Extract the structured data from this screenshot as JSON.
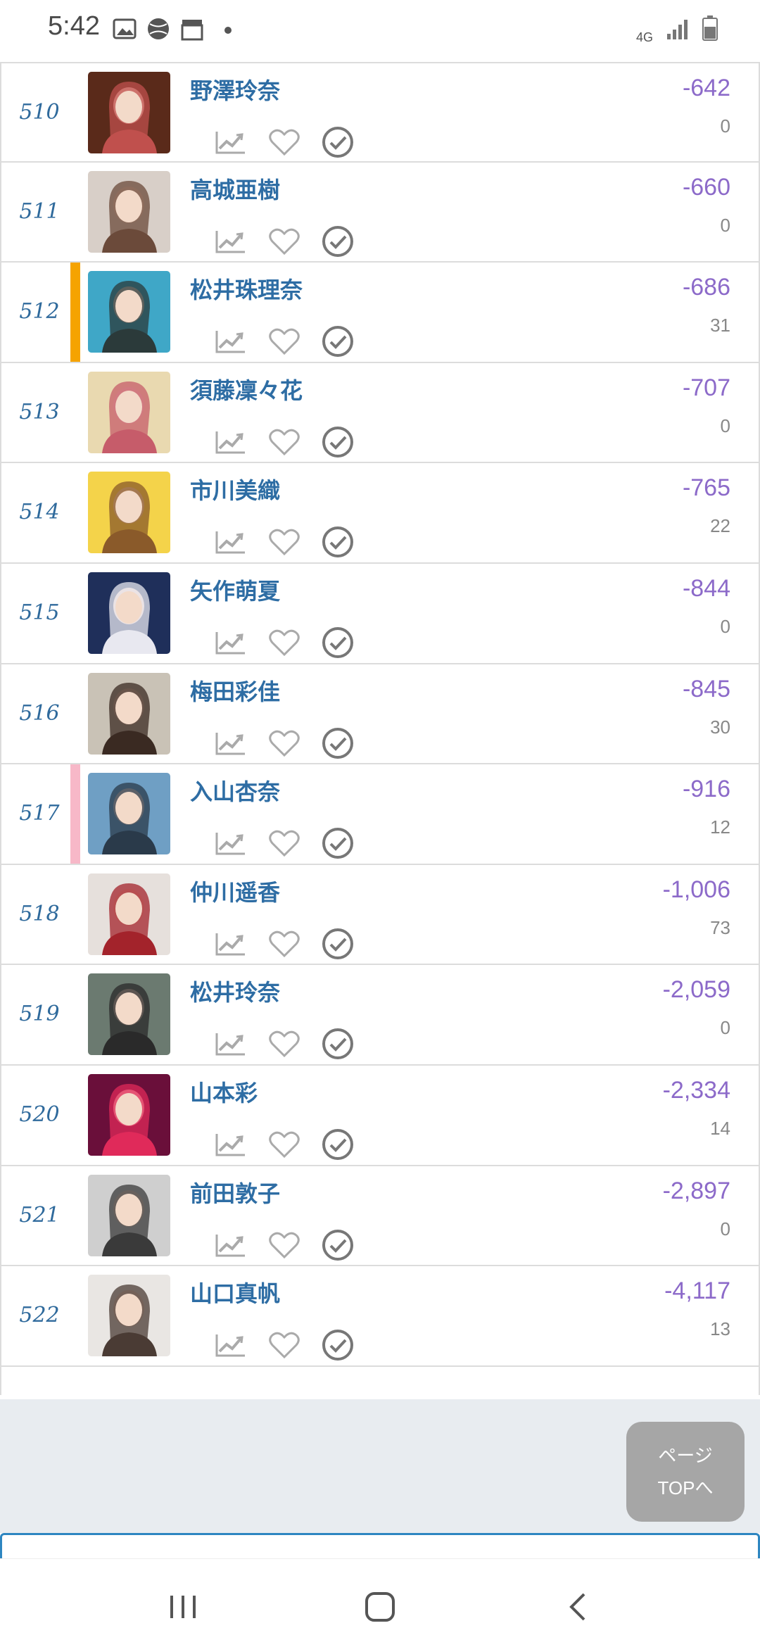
{
  "status_bar": {
    "time": "5:42",
    "network": "4G",
    "icons": [
      "gallery-icon",
      "sports-icon",
      "clapper-icon",
      "dot-icon",
      "signal-icon",
      "battery-icon"
    ]
  },
  "colors": {
    "name": "#2e6da4",
    "score": "#8c6ac9",
    "rank": "#2f6a9c",
    "marker_orange": "#f5a300",
    "marker_pink": "#f7b8c8"
  },
  "rows": [
    {
      "rank": "510",
      "name": "野澤玲奈",
      "score": "-642",
      "count": "0",
      "marker": ""
    },
    {
      "rank": "511",
      "name": "高城亜樹",
      "score": "-660",
      "count": "0",
      "marker": ""
    },
    {
      "rank": "512",
      "name": "松井珠理奈",
      "score": "-686",
      "count": "31",
      "marker": "orange"
    },
    {
      "rank": "513",
      "name": "須藤凜々花",
      "score": "-707",
      "count": "0",
      "marker": ""
    },
    {
      "rank": "514",
      "name": "市川美織",
      "score": "-765",
      "count": "22",
      "marker": ""
    },
    {
      "rank": "515",
      "name": "矢作萌夏",
      "score": "-844",
      "count": "0",
      "marker": ""
    },
    {
      "rank": "516",
      "name": "梅田彩佳",
      "score": "-845",
      "count": "30",
      "marker": ""
    },
    {
      "rank": "517",
      "name": "入山杏奈",
      "score": "-916",
      "count": "12",
      "marker": "pink"
    },
    {
      "rank": "518",
      "name": "仲川遥香",
      "score": "-1,006",
      "count": "73",
      "marker": ""
    },
    {
      "rank": "519",
      "name": "松井玲奈",
      "score": "-2,059",
      "count": "0",
      "marker": ""
    },
    {
      "rank": "520",
      "name": "山本彩",
      "score": "-2,334",
      "count": "14",
      "marker": ""
    },
    {
      "rank": "521",
      "name": "前田敦子",
      "score": "-2,897",
      "count": "0",
      "marker": ""
    },
    {
      "rank": "522",
      "name": "山口真帆",
      "score": "-4,117",
      "count": "13",
      "marker": ""
    }
  ],
  "top_button": {
    "line1": "ページ",
    "line2": "TOPへ"
  },
  "nav": [
    "recent-apps-icon",
    "home-icon",
    "back-icon"
  ]
}
